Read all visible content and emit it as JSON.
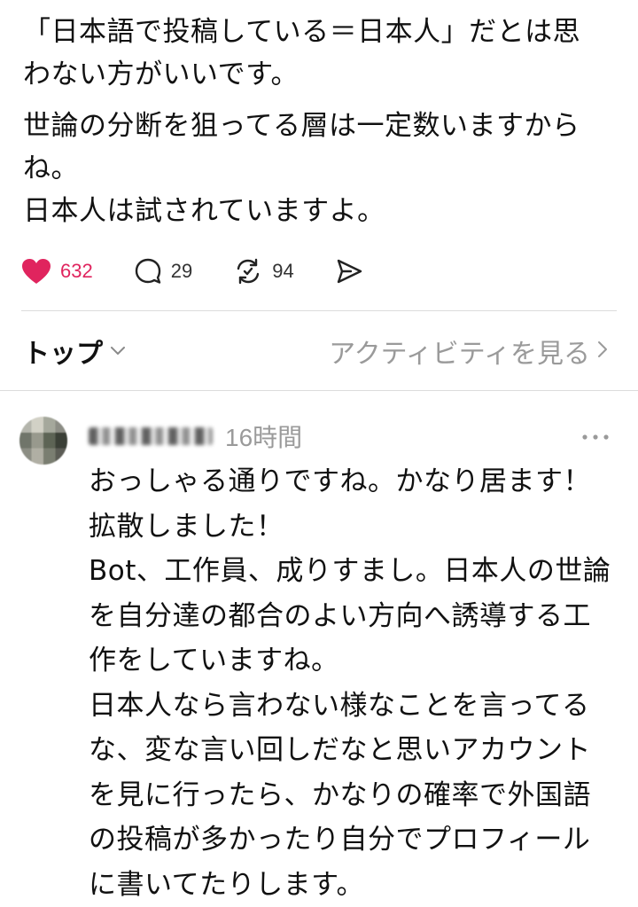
{
  "post": {
    "paragraphs": [
      [
        "「日本語で投稿している＝日本人」だとは思",
        "わない方がいいです。"
      ],
      [
        "世論の分断を狙ってる層は一定数いますから",
        "ね。",
        "日本人は試されていますよ。"
      ]
    ],
    "like_count": "632",
    "reply_count": "29",
    "repost_count": "94",
    "liked": true,
    "like_color": "#e0245e"
  },
  "sort": {
    "label": "トップ",
    "activity_link": "アクティビティを見る"
  },
  "reply": {
    "timestamp": "16時間",
    "lines": [
      "おっしゃる通りですね。かなり居ます！",
      "拡散しました！",
      "Bot、工作員、成りすまし。日本人の世論",
      "を自分達の都合のよい方向へ誘導する工",
      "作をしていますね。",
      "日本人なら言わない様なことを言ってる",
      "な、変な言い回しだなと思いアカウント",
      "を見に行ったら、かなりの確率で外国語",
      "の投稿が多かったり自分でプロフィール",
      "に書いてたりします。"
    ]
  },
  "icons": {
    "like": "heart-icon",
    "reply": "comment-bubble-icon",
    "repost": "repost-arrows-icon",
    "share": "send-icon",
    "sort_chevron": "chevron-down-icon",
    "activity_chevron": "chevron-right-icon",
    "more": "more-dots-icon"
  }
}
